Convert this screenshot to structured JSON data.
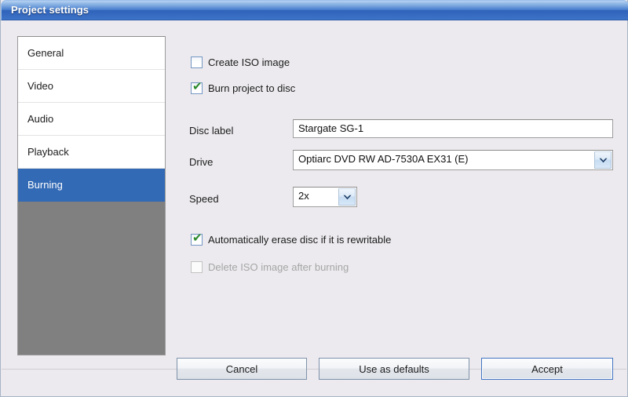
{
  "window": {
    "title": "Project settings"
  },
  "sidebar": {
    "items": [
      {
        "label": "General",
        "selected": false
      },
      {
        "label": "Video",
        "selected": false
      },
      {
        "label": "Audio",
        "selected": false
      },
      {
        "label": "Playback",
        "selected": false
      },
      {
        "label": "Burning",
        "selected": true
      }
    ]
  },
  "content": {
    "create_iso": {
      "label": "Create ISO image",
      "checked": false,
      "enabled": true
    },
    "burn_project": {
      "label": "Burn project to disc",
      "checked": true,
      "enabled": true
    },
    "disc_label": {
      "label": "Disc label",
      "value": "Stargate SG-1"
    },
    "drive": {
      "label": "Drive",
      "value": "Optiarc DVD RW AD-7530A EX31 (E)",
      "icon": "chevron-down-icon"
    },
    "speed": {
      "label": "Speed",
      "value": "2x",
      "icon": "chevron-down-icon"
    },
    "auto_erase": {
      "label": "Automatically erase disc if it is rewritable",
      "checked": true,
      "enabled": true
    },
    "delete_iso": {
      "label": "Delete ISO image after burning",
      "checked": false,
      "enabled": false
    },
    "check_glyph": "✔"
  },
  "footer": {
    "cancel_label": "Cancel",
    "use_defaults_label": "Use as defaults",
    "accept_label": "Accept"
  },
  "colors": {
    "title_bar": "#3f78ca",
    "selection": "#336ab5",
    "check_green": "#2c8a2c",
    "sidebar_empty": "#808080",
    "dialog_bg": "#eceaee",
    "default_button_border": "#3f72c0"
  }
}
